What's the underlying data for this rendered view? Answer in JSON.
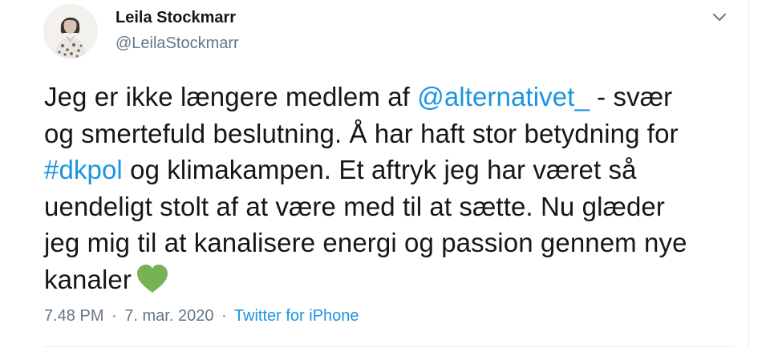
{
  "author": {
    "name": "Leila Stockmarr",
    "handle": "@LeilaStockmarr",
    "avatar_icon": "profile-photo"
  },
  "tweet": {
    "lines": [
      [
        "Jeg er ikke længere medlem af ",
        "@alternativet_",
        "  - svær"
      ],
      [
        "og smertefuld beslutning. Å har haft stor betydning for"
      ],
      [
        "#dkpol",
        " og klimakampen. Et aftryk jeg har været så"
      ],
      [
        "uendeligt stolt af at være med til at sætte. Nu glæder"
      ],
      [
        "jeg mig til at kanalisere energi og passion gennem nye"
      ],
      [
        "kanaler"
      ]
    ],
    "mention": "@alternativet_",
    "hashtag": "#dkpol",
    "emoji": "green-heart",
    "colors": {
      "text": "#14171a",
      "link": "#1b95e0",
      "secondary": "#657786",
      "heart": "#77b255"
    }
  },
  "meta": {
    "time": "7.48 PM",
    "separator": "·",
    "date": "7. mar. 2020",
    "source": "Twitter for iPhone"
  },
  "menu": {
    "icon": "chevron-down-icon"
  }
}
